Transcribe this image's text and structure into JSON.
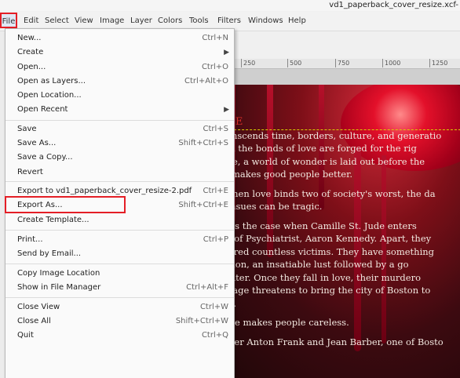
{
  "window": {
    "title": "vd1_paperback_cover_resize.xcf-"
  },
  "menubar": {
    "items": [
      "File",
      "Edit",
      "Select",
      "View",
      "Image",
      "Layer",
      "Colors",
      "Tools",
      "Filters",
      "Windows",
      "Help"
    ]
  },
  "ruler": {
    "ticks": [
      "250",
      "500",
      "750",
      "1000",
      "1250"
    ]
  },
  "file_menu": {
    "groups": [
      [
        {
          "label": "New...",
          "shortcut": "Ctrl+N"
        },
        {
          "label": "Create",
          "shortcut": "",
          "submenu": true
        },
        {
          "label": "Open...",
          "shortcut": "Ctrl+O"
        },
        {
          "label": "Open as Layers...",
          "shortcut": "Ctrl+Alt+O"
        },
        {
          "label": "Open Location...",
          "shortcut": ""
        },
        {
          "label": "Open Recent",
          "shortcut": "",
          "submenu": true
        }
      ],
      [
        {
          "label": "Save",
          "shortcut": "Ctrl+S"
        },
        {
          "label": "Save As...",
          "shortcut": "Shift+Ctrl+S"
        },
        {
          "label": "Save a Copy...",
          "shortcut": ""
        },
        {
          "label": "Revert",
          "shortcut": ""
        }
      ],
      [
        {
          "label": "Export to vd1_paperback_cover_resize-2.pdf",
          "shortcut": "Ctrl+E"
        },
        {
          "label": "Export As...",
          "shortcut": "Shift+Ctrl+E"
        },
        {
          "label": "Create Template...",
          "shortcut": ""
        }
      ],
      [
        {
          "label": "Print...",
          "shortcut": "Ctrl+P"
        },
        {
          "label": "Send by Email...",
          "shortcut": ""
        }
      ],
      [
        {
          "label": "Copy Image Location",
          "shortcut": ""
        },
        {
          "label": "Show in File Manager",
          "shortcut": "Ctrl+Alt+F"
        }
      ],
      [
        {
          "label": "Close View",
          "shortcut": "Ctrl+W"
        },
        {
          "label": "Close All",
          "shortcut": "Shift+Ctrl+W"
        },
        {
          "label": "Quit",
          "shortcut": "Ctrl+Q"
        }
      ]
    ]
  },
  "canvas_text": {
    "lines": [
      "OVE",
      "transcends time, borders, culture, and generatio",
      "hen the bonds of love are forged for the rig",
      "ople, a world of wonder is laid out before the",
      "ve makes good people better.",
      "",
      "t when love binds two of society's worst, the da",
      "t ensues can be tragic.",
      "",
      "ch is the case when Camille St. Jude enters",
      "rld of Psychiatrist, Aaron Kennedy. Apart, they",
      "rdered countless victims. They have something",
      "mmon, an insatiable lust followed by a go",
      "ughter. Once they fall in love, their murdero",
      "mpage threatens to bring the city of Boston to",
      "ees.",
      "",
      "Love makes people careless.",
      "",
      "Enter Anton Frank and Jean Barber, one of Bosto"
    ]
  },
  "colors": {
    "highlight": "#e41e26",
    "menu_bg": "#fafafa"
  }
}
